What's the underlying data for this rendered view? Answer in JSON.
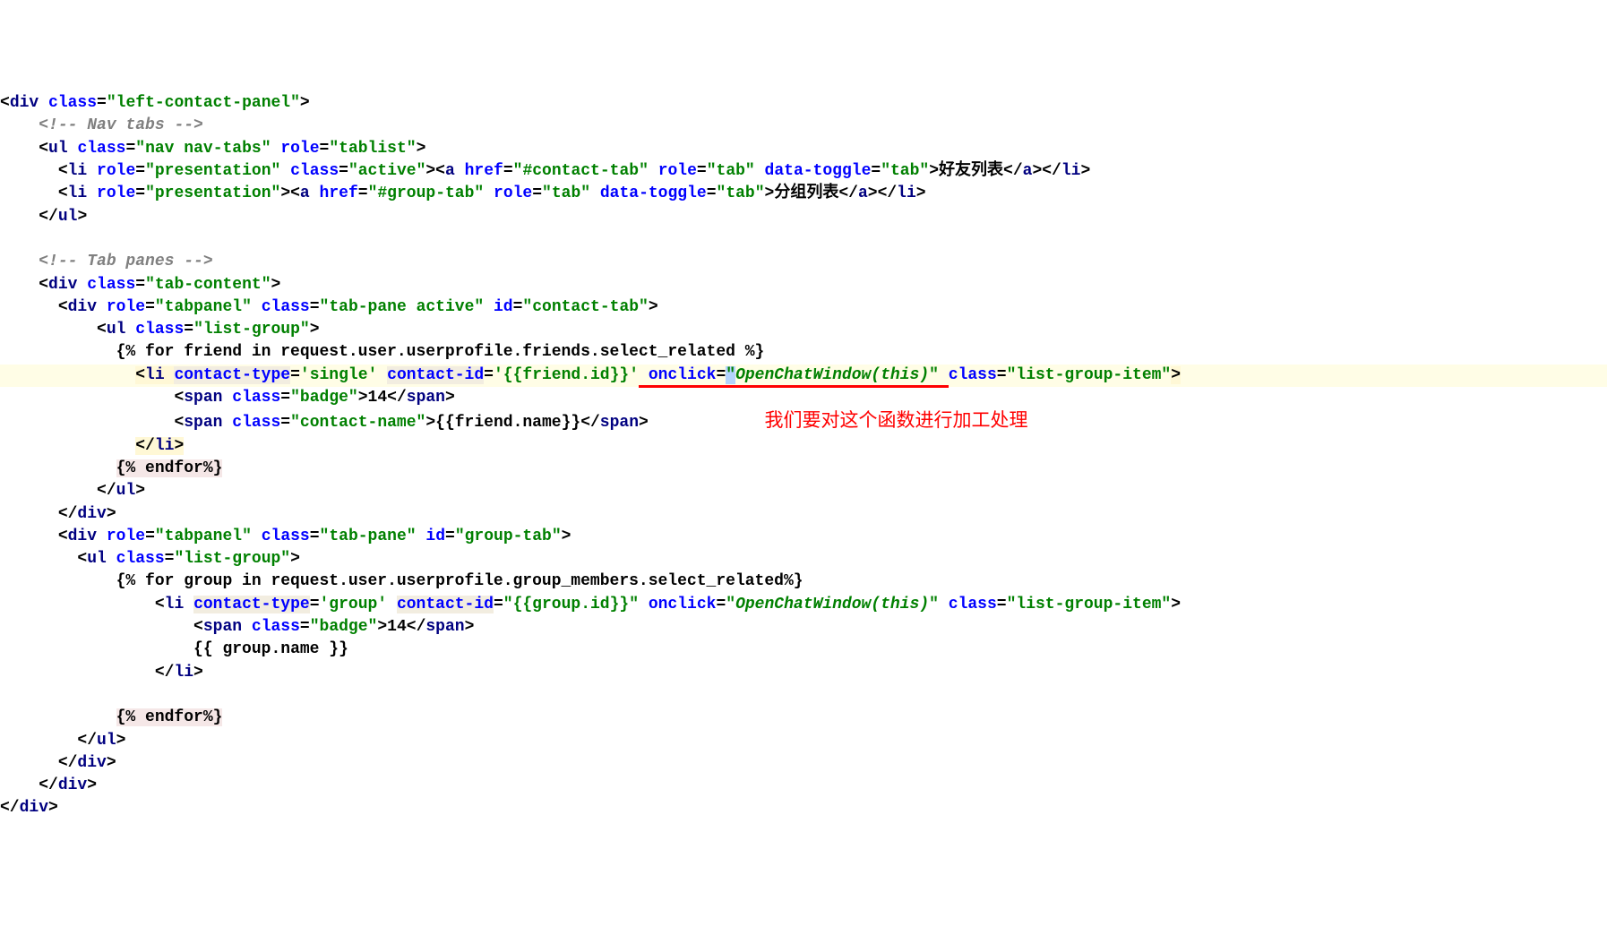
{
  "code": {
    "div_open": "div",
    "div_close": "div",
    "ul_open": "ul",
    "ul_close": "ul",
    "li_open": "li",
    "li_close": "li",
    "a_open": "a",
    "a_close": "a",
    "span_open": "span",
    "span_close": "span",
    "class_attr": "class",
    "role_attr": "role",
    "href_attr": "href",
    "id_attr": "id",
    "data_toggle_attr": "data-toggle",
    "onclick_attr": "onclick",
    "contact_type_attr": "contact-type",
    "contact_id_attr": "contact-id",
    "left_contact_panel": "\"left-contact-panel\"",
    "nav_tabs": "\"nav nav-tabs\"",
    "tablist": "\"tablist\"",
    "presentation": "\"presentation\"",
    "active": "\"active\"",
    "contact_tab_href": "\"#contact-tab\"",
    "group_tab_href": "\"#group-tab\"",
    "tab_val": "\"tab\"",
    "tab_content": "\"tab-content\"",
    "tabpanel": "\"tabpanel\"",
    "tab_pane_active": "\"tab-pane active\"",
    "tab_pane": "\"tab-pane\"",
    "contact_tab_id": "\"contact-tab\"",
    "group_tab_id": "\"group-tab\"",
    "list_group": "\"list-group\"",
    "list_group_item": "\"list-group-item\"",
    "badge": "\"badge\"",
    "contact_name": "\"contact-name\"",
    "single_val": "'single'",
    "group_val": "'group'",
    "friend_id_tpl": "'{{friend.id}}'",
    "group_id_tpl": "\"{{group.id}}\"",
    "onclick_val_open": "\"",
    "onclick_func": "OpenChatWindow(",
    "onclick_this": "this",
    "onclick_close": ")",
    "onclick_val_close": "\"",
    "comment_nav": "<!-- Nav tabs -->",
    "comment_panes": "<!-- Tab panes -->",
    "friends_label": "好友列表",
    "groups_label": "分组列表",
    "badge_14": "14",
    "friend_name_tpl": "{{friend.name}}",
    "group_name_tpl": "{{ group.name }}",
    "for_friend": "{% for friend in request.user.userprofile.friends.select_related %}",
    "for_group": "{% for group in request.user.userprofile.group_members.select_related%}",
    "endfor": "{% endfor%}"
  },
  "annotation_text": "我们要对这个函数进行加工处理"
}
